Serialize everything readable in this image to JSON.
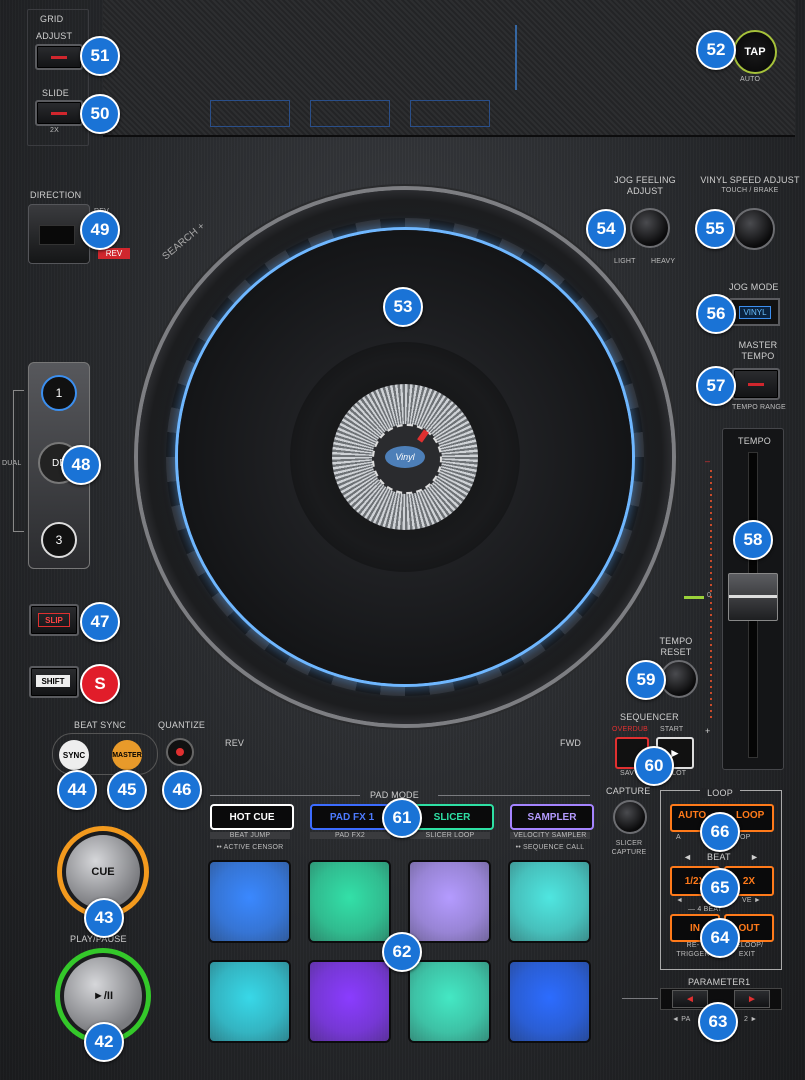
{
  "grid": {
    "title": "GRID",
    "adjust": "ADJUST",
    "slide": "SLIDE",
    "slide_sub": "2X"
  },
  "tap": {
    "label": "TAP",
    "sub": "AUTO"
  },
  "direction": {
    "title": "DIRECTION",
    "rev_text": "REV",
    "rev_sub": "REV"
  },
  "jog": {
    "search": "SEARCH +",
    "rev": "REV",
    "fwd": "FWD",
    "center": "Vinyl"
  },
  "jog_feeling": {
    "title": "JOG FEELING",
    "title2": "ADJUST",
    "light": "LIGHT",
    "heavy": "HEAVY"
  },
  "vinyl_speed": {
    "title": "VINYL SPEED ADJUST",
    "sub": "TOUCH / BRAKE"
  },
  "jog_mode": {
    "title": "JOG MODE",
    "button": "VINYL"
  },
  "master_tempo": {
    "title": "MASTER",
    "title2": "TEMPO",
    "sub": "TEMPO RANGE"
  },
  "tempo": {
    "title": "TEMPO",
    "minus": "–",
    "plus": "+",
    "zero": "0"
  },
  "tempo_reset": {
    "title": "TEMPO",
    "title2": "RESET"
  },
  "deck": {
    "dual": "DUAL",
    "b1": "1",
    "b2": "DE",
    "b3": "3"
  },
  "slip": {
    "label": "SLIP"
  },
  "shift": {
    "label": "SHIFT"
  },
  "beat_sync": {
    "title": "BEAT SYNC",
    "sync": "SYNC",
    "master": "MASTER"
  },
  "quantize": {
    "title": "QUANTIZE"
  },
  "sequencer": {
    "title": "SEQUENCER",
    "overdub": "OVERDUB",
    "start": "START",
    "sub_left": "SAV",
    "sub_right": "LOT"
  },
  "capture": {
    "title": "CAPTURE",
    "sub1": "SLICER",
    "sub2": "CAPTURE"
  },
  "pad_mode": {
    "title": "PAD MODE",
    "buttons": [
      {
        "label": "HOT CUE",
        "sub": "BEAT JUMP",
        "sub2": "•• ACTIVE CENSOR"
      },
      {
        "label": "PAD FX 1",
        "sub": "PAD FX2",
        "sub2": ""
      },
      {
        "label": "SLICER",
        "sub": "SLICER LOOP",
        "sub2": ""
      },
      {
        "label": "SAMPLER",
        "sub": "VELOCITY SAMPLER",
        "sub2": "•• SEQUENCE CALL"
      }
    ]
  },
  "pads": {
    "colors": [
      "#3a88ff",
      "#33e0a8",
      "#b49bff",
      "#4fe6e0",
      "#38d8e8",
      "#8a3cff",
      "#44e8c4",
      "#2c6cff"
    ]
  },
  "cue": {
    "label": "CUE"
  },
  "play": {
    "title": "PLAY/PAUSE",
    "label": "►/II"
  },
  "loop": {
    "title": "LOOP",
    "auto": "AUTO",
    "auto_right": "LOOP",
    "auto_sub_left": "A",
    "auto_sub_right": "OP",
    "beat": "BEAT",
    "half": "1/2X",
    "double": "2X",
    "beat_sub_left": "◄",
    "beat_sub_right": "VE ►",
    "four_beat": "— 4 BEAT",
    "in": "IN",
    "out": "OUT",
    "retrigger1": "RE-",
    "retrigger2": "TRIGGER",
    "reloop1": "RELOOP/",
    "reloop2": "EXIT"
  },
  "parameter": {
    "title": "PARAMETER1",
    "sub_left": "◄ PA",
    "sub_right": "2 ►"
  },
  "badges": [
    "51",
    "52",
    "50",
    "49",
    "53",
    "54",
    "55",
    "56",
    "57",
    "48",
    "58",
    "47",
    "S",
    "59",
    "44",
    "45",
    "46",
    "60",
    "61",
    "66",
    "43",
    "65",
    "62",
    "64",
    "42",
    "63"
  ],
  "colors": {
    "badge": "#1a73d6",
    "badge_red": "#e11d2a",
    "led_red": "#d0262d",
    "cue_ring": "#f39a1e",
    "play_ring": "#34c82a",
    "loop_orange": "#ff7a1a"
  }
}
